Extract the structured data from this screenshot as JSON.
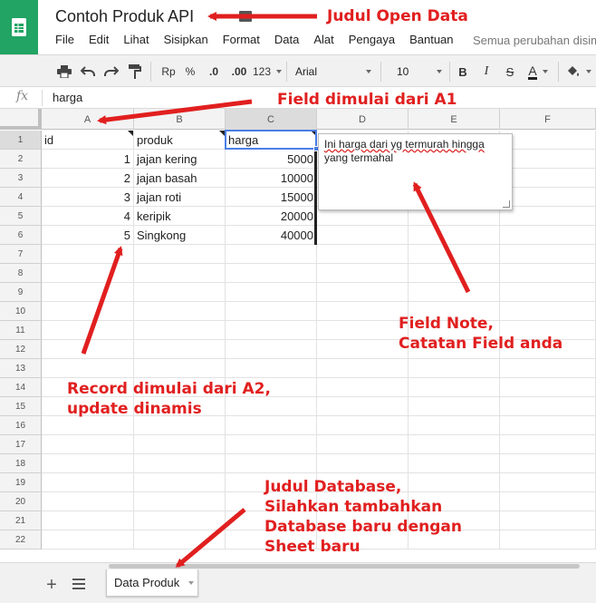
{
  "app": {
    "doc_title": "Contoh Produk API",
    "save_status": "Semua perubahan disim"
  },
  "menu": [
    "File",
    "Edit",
    "Lihat",
    "Sisipkan",
    "Format",
    "Data",
    "Alat",
    "Pengaya",
    "Bantuan"
  ],
  "toolbar": {
    "print_icon": "printer-icon",
    "undo_icon": "undo-icon",
    "redo_icon": "redo-icon",
    "paint_icon": "paint-format-icon",
    "currency": "Rp",
    "percent": "%",
    "decrease_decimal": ".0",
    "increase_decimal": ".00",
    "number_format": "123",
    "font": "Arial",
    "font_size": "10",
    "bold": "B",
    "italic": "I",
    "strike": "S",
    "text_color": "A",
    "fill_icon": "fill-color-icon"
  },
  "formula_bar": {
    "fx": "fx",
    "value": "harga"
  },
  "columns": [
    "A",
    "B",
    "C",
    "D",
    "E",
    "F"
  ],
  "rows": [
    "1",
    "2",
    "3",
    "4",
    "5",
    "6",
    "7",
    "8",
    "9",
    "10",
    "11",
    "12",
    "13",
    "14",
    "15",
    "16",
    "17",
    "18",
    "19",
    "20",
    "21",
    "22"
  ],
  "table": {
    "headers": [
      "id",
      "produk",
      "harga"
    ],
    "records": [
      [
        "1",
        "jajan kering",
        "5000"
      ],
      [
        "2",
        "jajan basah",
        "10000"
      ],
      [
        "3",
        "jajan roti",
        "15000"
      ],
      [
        "4",
        "keripik",
        "20000"
      ],
      [
        "5",
        "Singkong",
        "40000"
      ]
    ]
  },
  "note": {
    "text_underlined": "Ini harga dari yg termurah hingga",
    "text_rest": "yang termahal"
  },
  "sheet": {
    "add_label": "+",
    "tab_name": "Data Produk"
  },
  "annotations": {
    "title_note": "Judul Open Data",
    "field_note": "Field dimulai dari A1",
    "fieldnote_line1": "Field Note,",
    "fieldnote_line2": "Catatan Field anda",
    "record_line1": "Record dimulai dari A2,",
    "record_line2": "update dinamis",
    "db_line1": "Judul Database,",
    "db_line2": "Silahkan tambahkan",
    "db_line3": "Database baru dengan",
    "db_line4": "Sheet baru"
  },
  "colors": {
    "brand": "#21a464",
    "annotation": "#e11f1f",
    "selection": "#4a7ee6"
  }
}
